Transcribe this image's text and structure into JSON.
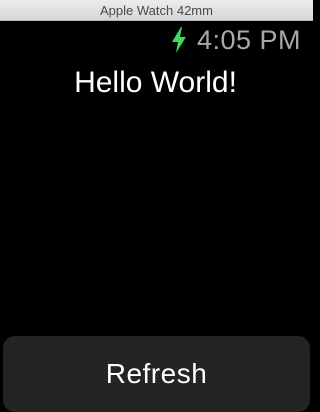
{
  "window": {
    "title": "Apple Watch 42mm"
  },
  "status": {
    "time": "4:05 PM",
    "charge_icon": "charging-bolt-icon",
    "charge_color": "#3ddc58"
  },
  "content": {
    "greeting": "Hello World!"
  },
  "actions": {
    "refresh_label": "Refresh"
  },
  "colors": {
    "background": "#000000",
    "time_text": "#a8a8ad",
    "button_bg": "#242424"
  }
}
